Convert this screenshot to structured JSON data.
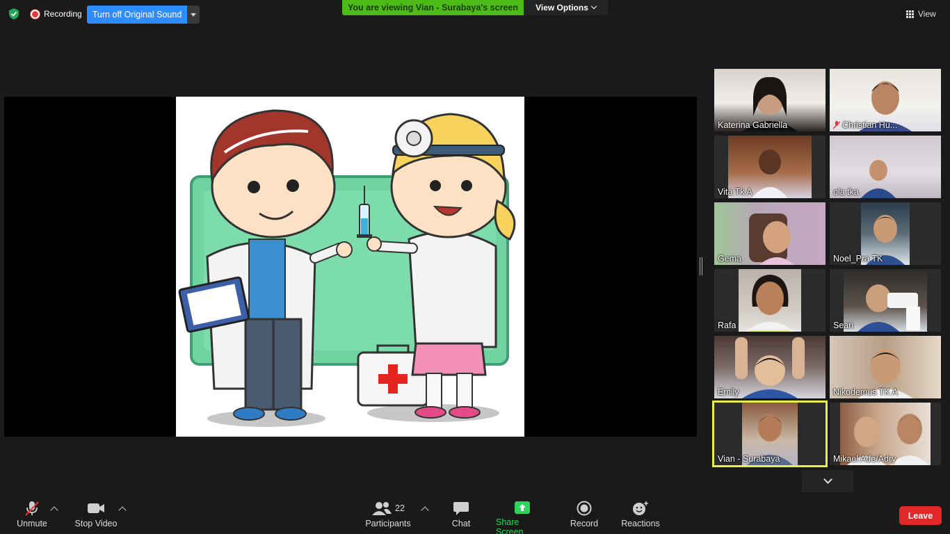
{
  "top_bar": {
    "recording_label": "Recording",
    "original_sound_button": "Turn off Original Sound",
    "viewing_banner": "You are viewing Vian - Surabaya's screen",
    "view_options_label": "View Options",
    "view_label": "View"
  },
  "gallery": [
    {
      "name": "Katerina Gabriella",
      "muted": false,
      "active": false
    },
    {
      "name": "Christian Hu...",
      "muted": true,
      "active": false
    },
    {
      "name": "Vita Tk A",
      "muted": false,
      "active": false
    },
    {
      "name": "ola tka",
      "muted": false,
      "active": false
    },
    {
      "name": "Gema",
      "muted": false,
      "active": false
    },
    {
      "name": "Noel_Pra TK",
      "muted": false,
      "active": false
    },
    {
      "name": "Rafa",
      "muted": false,
      "active": false
    },
    {
      "name": "Sean",
      "muted": false,
      "active": false
    },
    {
      "name": "Emily",
      "muted": false,
      "active": false
    },
    {
      "name": "Nikodemus TK A",
      "muted": false,
      "active": false
    },
    {
      "name": "Vian - Surabaya",
      "muted": false,
      "active": true
    },
    {
      "name": "Mikael Ade/Adry",
      "muted": false,
      "active": false
    }
  ],
  "toolbar": {
    "unmute_label": "Unmute",
    "stop_video_label": "Stop Video",
    "participants_label": "Participants",
    "participants_count": "22",
    "chat_label": "Chat",
    "share_screen_label": "Share Screen",
    "record_label": "Record",
    "reactions_label": "Reactions",
    "leave_label": "Leave"
  },
  "colors": {
    "accent_blue": "#2d8cff",
    "share_green": "#4cbb17",
    "leave_red": "#e02828",
    "active_speaker": "#e6f04a"
  }
}
